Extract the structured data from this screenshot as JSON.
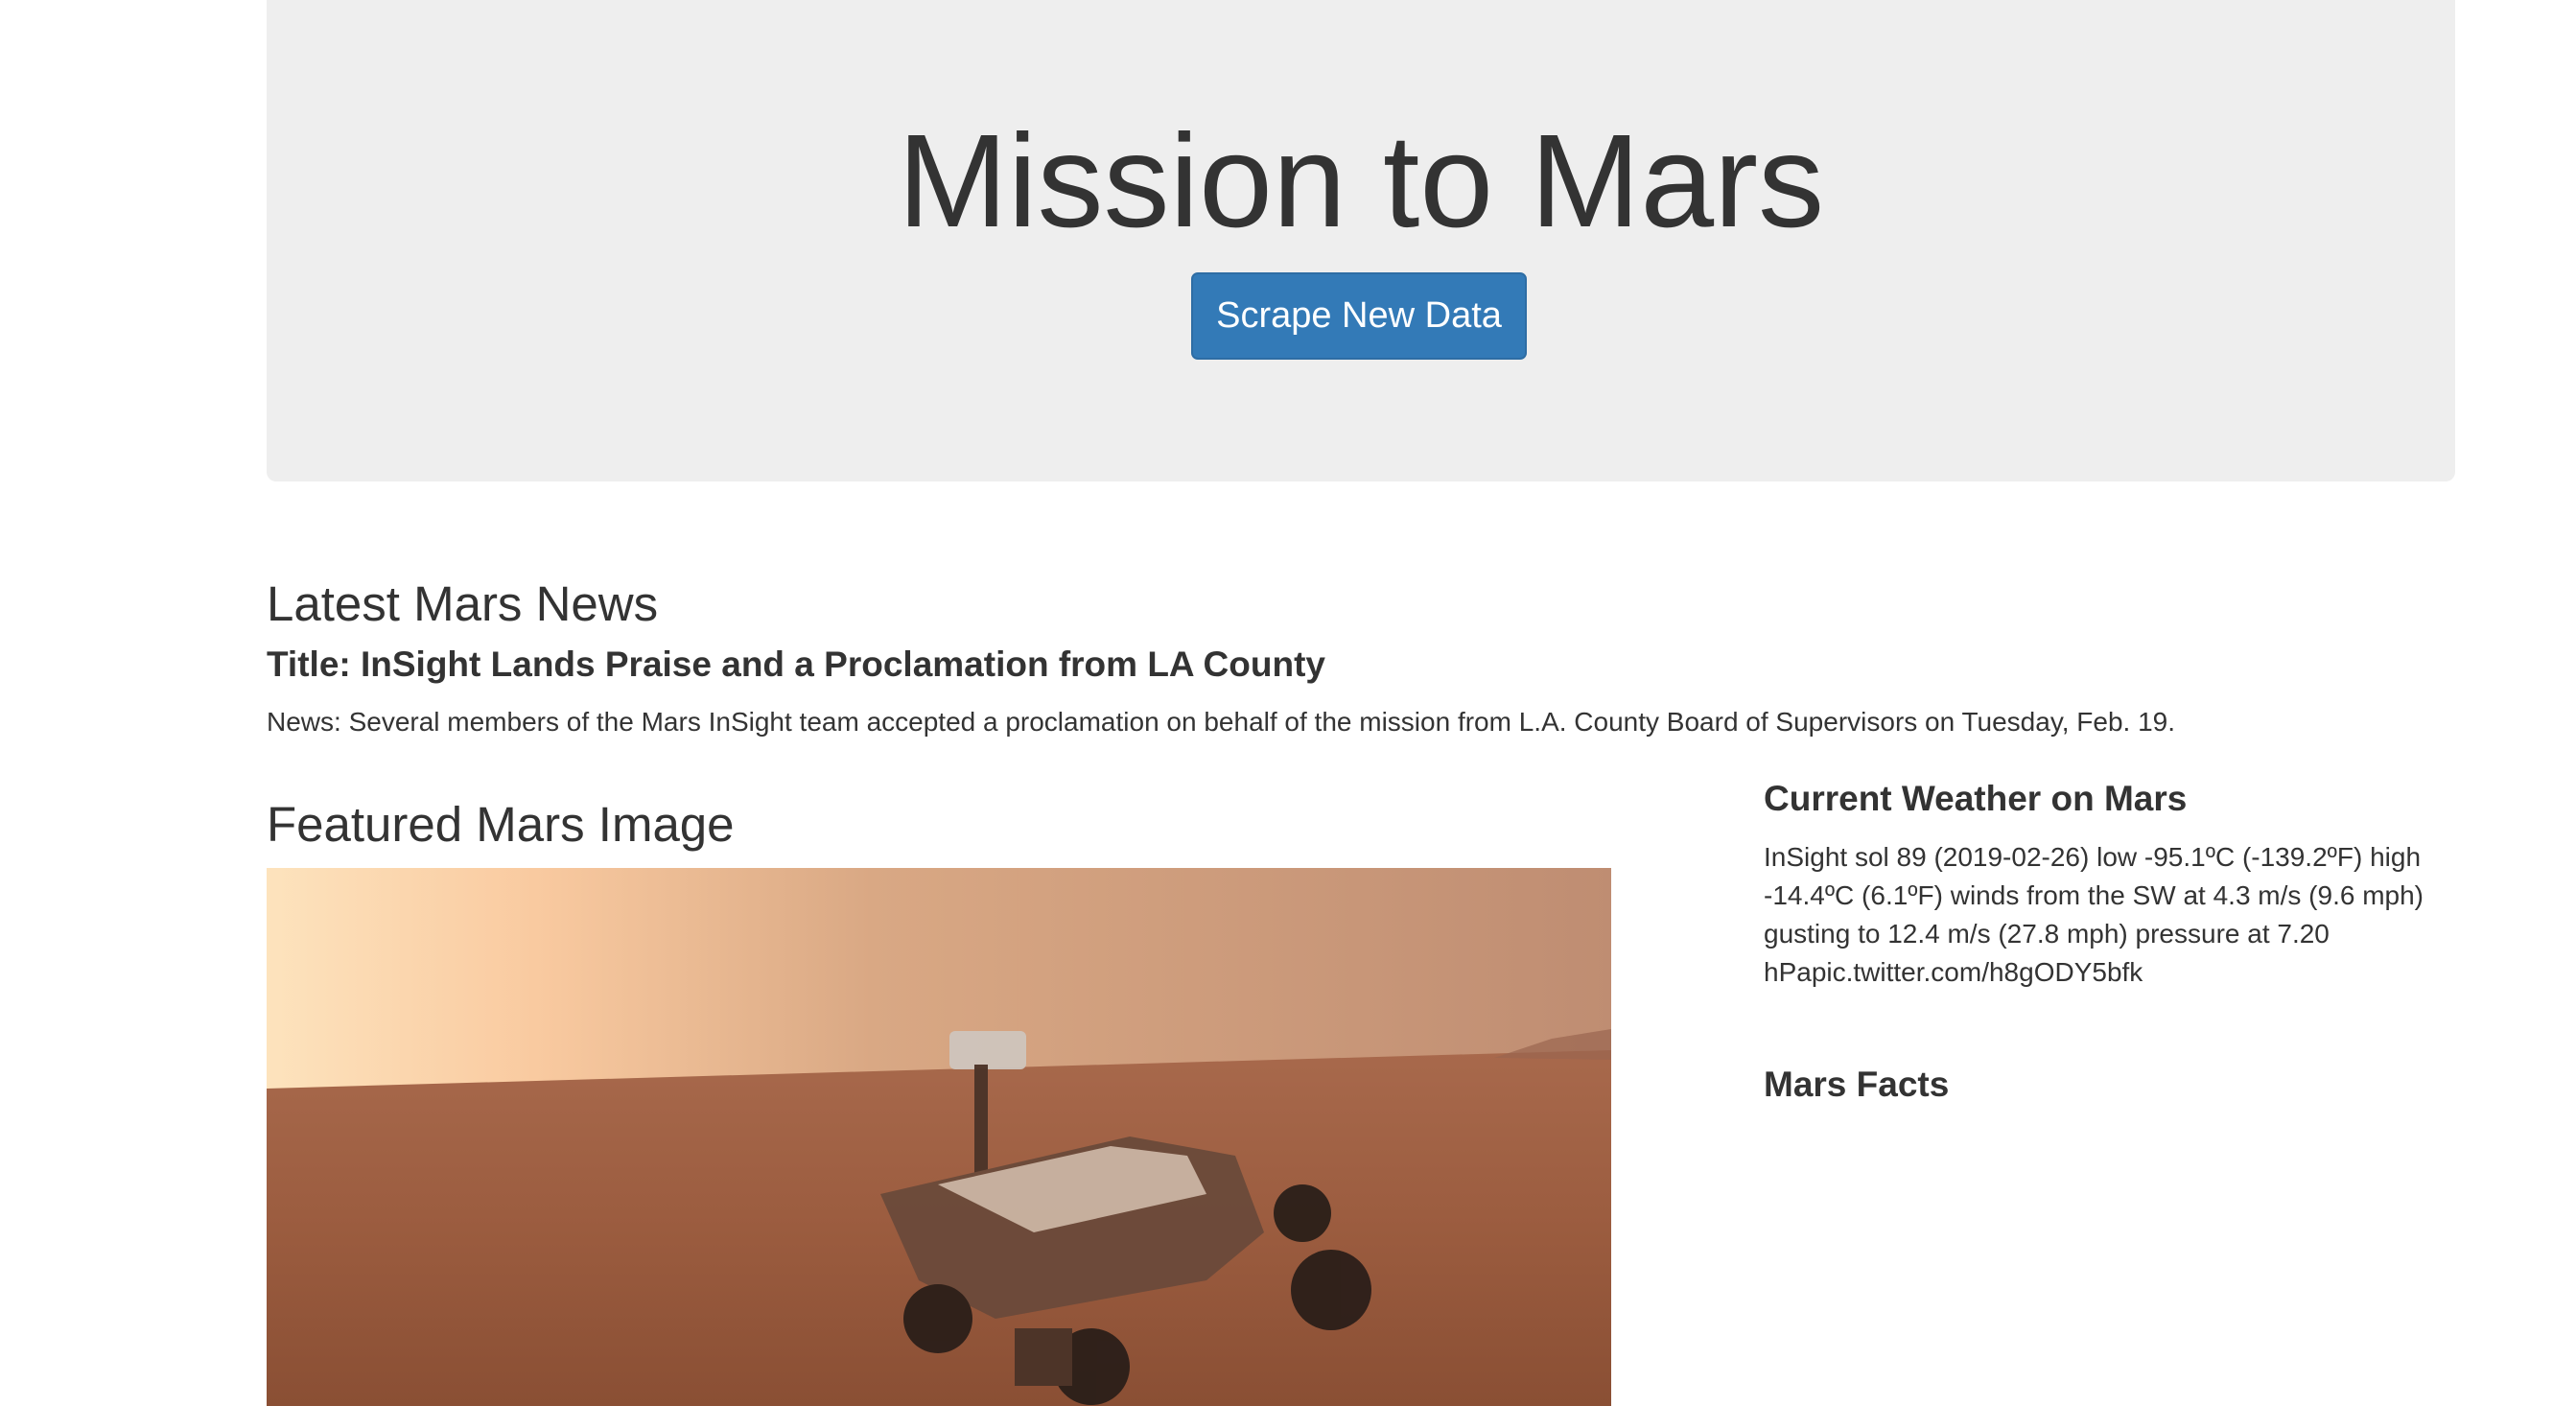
{
  "jumbotron": {
    "title": "Mission to Mars",
    "button_label": "Scrape New Data"
  },
  "news": {
    "heading": "Latest Mars News",
    "title": "Title: InSight Lands Praise and a Proclamation from LA County",
    "body": "News: Several members of the Mars InSight team accepted a proclamation on behalf of the mission from L.A. County Board of Supervisors on Tuesday, Feb. 19."
  },
  "featured_image": {
    "heading": "Featured Mars Image"
  },
  "weather": {
    "heading": "Current Weather on Mars",
    "text": "InSight sol 89 (2019-02-26) low -95.1ºC (-139.2ºF) high -14.4ºC (6.1ºF) winds from the SW at 4.3 m/s (9.6 mph) gusting to 12.4 m/s (27.8 mph) pressure at 7.20 hPapic.twitter.com/h8gODY5bfk"
  },
  "facts": {
    "heading": "Mars Facts"
  },
  "colors": {
    "jumbotron_bg": "#eeeeee",
    "button_bg": "#337ab7",
    "text": "#333333"
  }
}
